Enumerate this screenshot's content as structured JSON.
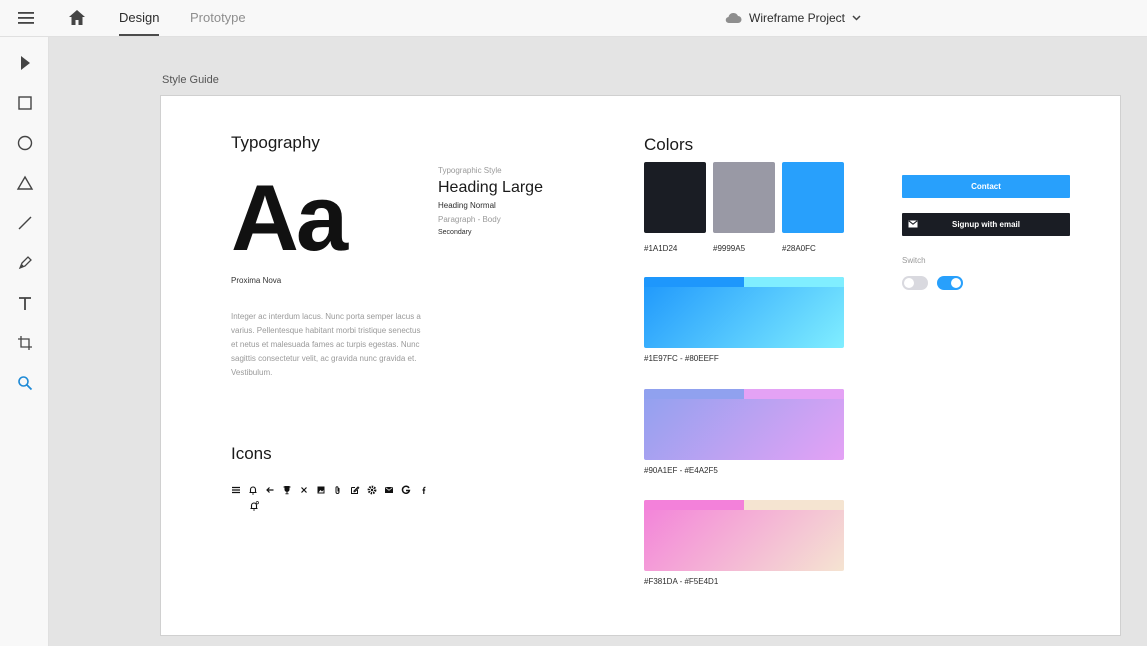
{
  "header": {
    "tabs": [
      {
        "label": "Design",
        "active": true
      },
      {
        "label": "Prototype",
        "active": false
      }
    ],
    "project_name": "Wireframe Project"
  },
  "toolbar": {
    "tools": [
      "select-icon",
      "rectangle-icon",
      "ellipse-icon",
      "triangle-icon",
      "line-icon",
      "pen-icon",
      "text-icon",
      "artboard-icon",
      "zoom-icon"
    ]
  },
  "canvas": {
    "artboard_label": "Style Guide"
  },
  "typography": {
    "title": "Typography",
    "sample": "Aa",
    "font_name": "Proxima Nova",
    "paragraph": "Integer ac interdum lacus. Nunc porta semper lacus a varius. Pellentesque habitant morbi tristique senectus et netus et malesuada fames ac turpis egestas. Nunc sagittis consectetur velit, ac gravida nunc gravida et. Vestibulum.",
    "style_label": "Typographic Style",
    "heading_large": "Heading Large",
    "heading_normal": "Heading Normal",
    "paragraph_body": "Paragraph - Body",
    "secondary": "Secondary"
  },
  "icons": {
    "title": "Icons",
    "items": [
      "menu-icon",
      "bell-icon",
      "arrow-left-icon",
      "trophy-icon",
      "close-icon",
      "image-icon",
      "attachment-icon",
      "edit-icon",
      "settings-icon",
      "mail-icon",
      "google-icon",
      "facebook-icon"
    ],
    "extra": "bell-notification-icon"
  },
  "colors": {
    "title": "Colors",
    "swatches": [
      {
        "label": "#1A1D24",
        "color": "#1a1d24"
      },
      {
        "label": "#9999A5",
        "color": "#9999a5"
      },
      {
        "label": "#28A0FC",
        "color": "#28a0fc"
      }
    ],
    "gradients": [
      {
        "label": "#1E97FC - #80EEFF",
        "from": "#1e97fc",
        "to": "#80eeff"
      },
      {
        "label": "#90A1EF - #E4A2F5",
        "from": "#90a1ef",
        "to": "#e4a2f5"
      },
      {
        "label": "#F381DA - #F5E4D1",
        "from": "#f381da",
        "to": "#f5e4d1"
      }
    ]
  },
  "components": {
    "contact_button": "Contact",
    "signup_button": "Signup with email",
    "switch_label": "Switch",
    "switch_states": [
      false,
      true
    ]
  }
}
